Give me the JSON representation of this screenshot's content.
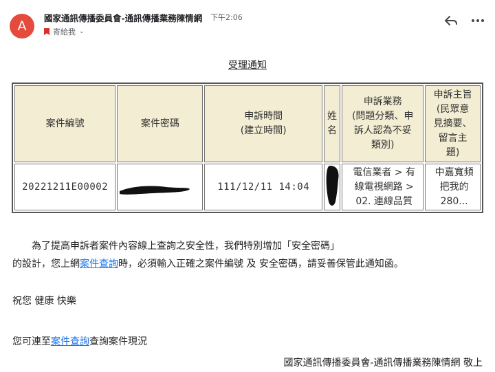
{
  "header": {
    "avatar_letter": "A",
    "sender": "國家通訊傳播委員會-通訊傳播業務陳情網",
    "time": "下午2:06",
    "recipient": "寄給我",
    "accent_color": "#e44b3c"
  },
  "notice": {
    "title": "受理通知",
    "table": {
      "headers": {
        "case_no": "案件編號",
        "password": "案件密碼",
        "time_l1": "申訴時間",
        "time_l2": "(建立時間)",
        "name": "姓名",
        "biz_l1": "申訴業務",
        "biz_l2": "(問題分類、申",
        "biz_l3": "訴人認為不妥",
        "biz_l4": "類別)",
        "subj_l1": "申訴主旨",
        "subj_l2": "(民眾意",
        "subj_l3": "見摘要、",
        "subj_l4": "留言主",
        "subj_l5": "題)"
      },
      "row": {
        "case_no": "20221211E00002",
        "time": "111/12/11 14:04",
        "biz_l1": "電信業者 > 有",
        "biz_l2": "線電視網路 >",
        "biz_l3": "02. 連線品質",
        "subj_l1": "中嘉寬頻",
        "subj_l2": "把我的",
        "subj_l3": "280..."
      }
    }
  },
  "body": {
    "p1": "為了提高申訴者案件內容線上查詢之安全性，我們特別增加「安全密碼」",
    "p2_pre": "的設計，您上網",
    "p2_link": "案件查詢",
    "p2_post": "時，必須輸入正確之案件編號 及 安全密碼，請妥善保管此通知函。",
    "greeting": "祝您 健康 快樂",
    "p3_pre": "您可連至",
    "p3_link": "案件查詢",
    "p3_post": "查詢案件現況",
    "signature": "國家通訊傳播委員會-通訊傳播業務陳情網 敬上"
  }
}
